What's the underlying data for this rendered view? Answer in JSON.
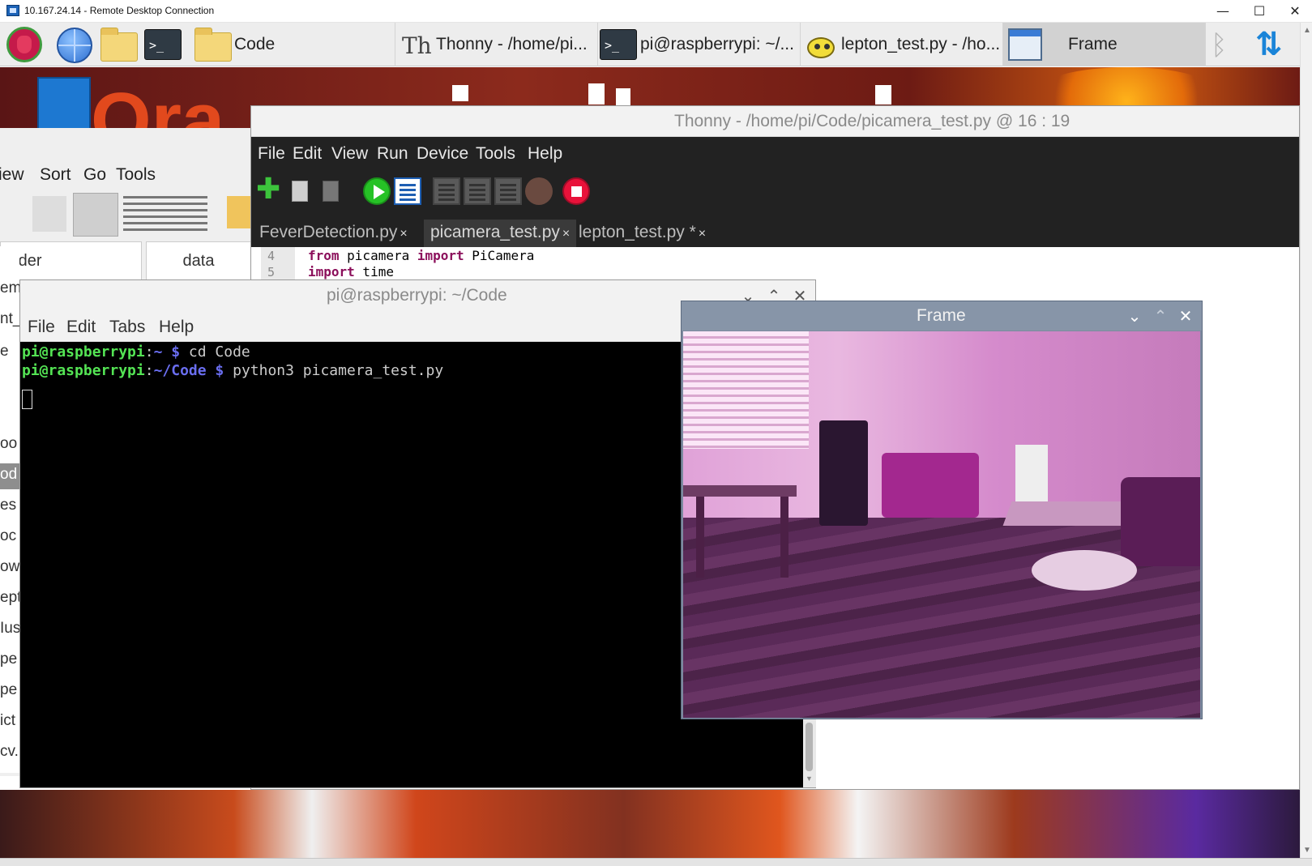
{
  "rdp": {
    "title": "10.167.24.14 - Remote Desktop Connection",
    "controls": {
      "minimize": "—",
      "maximize": "☐",
      "close": "✕"
    }
  },
  "taskbar": {
    "launchers": [
      "raspberry-menu-icon",
      "web-browser-icon",
      "file-manager-icon",
      "terminal-icon"
    ],
    "tasks": [
      {
        "label": "Code",
        "icon": "folder-icon"
      },
      {
        "label": "Thonny  -  /home/pi...",
        "icon": "thonny-icon"
      },
      {
        "label": "pi@raspberrypi: ~/...",
        "icon": "terminal-icon"
      },
      {
        "label": "lepton_test.py - /ho...",
        "icon": "thonny-teapot-icon"
      },
      {
        "label": "Frame",
        "icon": "window-icon",
        "active": true
      }
    ],
    "tray": {
      "bluetooth": "bluetooth-icon",
      "network": "network-transfer-icon"
    }
  },
  "file_manager": {
    "menu": [
      "iew",
      "Sort",
      "Go",
      "Tools"
    ],
    "column_left": "older",
    "column_right": "data",
    "side_items": [
      "em",
      "nt_",
      "e",
      "oo",
      "od",
      "es",
      "oc",
      "ow",
      "ept",
      "Ius",
      "pe",
      "pe",
      "ict",
      "cv."
    ],
    "selected_side_index": 4
  },
  "thonny": {
    "title": "Thonny  -  /home/pi/Code/picamera_test.py  @  16 : 19",
    "menu": [
      "File",
      "Edit",
      "View",
      "Run",
      "Device",
      "Tools",
      "Help"
    ],
    "toolbar": [
      "new-file-icon",
      "open-file-icon",
      "save-file-icon",
      "run-icon",
      "debug-icon",
      "step-over-icon",
      "step-into-icon",
      "step-out-icon",
      "resume-icon",
      "stop-icon"
    ],
    "tabs": [
      {
        "label": "FeverDetection.py",
        "close": "×",
        "active": false
      },
      {
        "label": "picamera_test.py",
        "close": "×",
        "active": true
      },
      {
        "label": "lepton_test.py *",
        "close": "×",
        "active": false
      }
    ],
    "code": [
      {
        "line": "4",
        "kw1": "from",
        "mid": " picamera ",
        "kw2": "import",
        "rest": " PiCamera"
      },
      {
        "line": "5",
        "kw1": "import",
        "mid": " time",
        "kw2": "",
        "rest": ""
      }
    ]
  },
  "terminal": {
    "title": "pi@raspberrypi: ~/Code",
    "menu": [
      "File",
      "Edit",
      "Tabs",
      "Help"
    ],
    "lines": [
      {
        "user": "pi@raspberrypi",
        "sep": ":",
        "path": "~ $",
        "cmd": " cd Code"
      },
      {
        "user": "pi@raspberrypi",
        "sep": ":",
        "path": "~/Code $",
        "cmd": " python3 picamera_test.py"
      }
    ],
    "win_buttons": {
      "minimize": "⌄",
      "maximize": "⌃",
      "close": "✕"
    }
  },
  "frame": {
    "title": "Frame",
    "win_buttons": {
      "minimize": "⌄",
      "maximize": "⌃",
      "close": "✕"
    },
    "content": "camera-preview-image"
  },
  "colors": {
    "thonny_dark": "#222222",
    "terminal_user": "#54e454",
    "terminal_path": "#6a6ef0",
    "keyword": "#8b0f5b",
    "frame_titlebar": "#8795a8"
  }
}
